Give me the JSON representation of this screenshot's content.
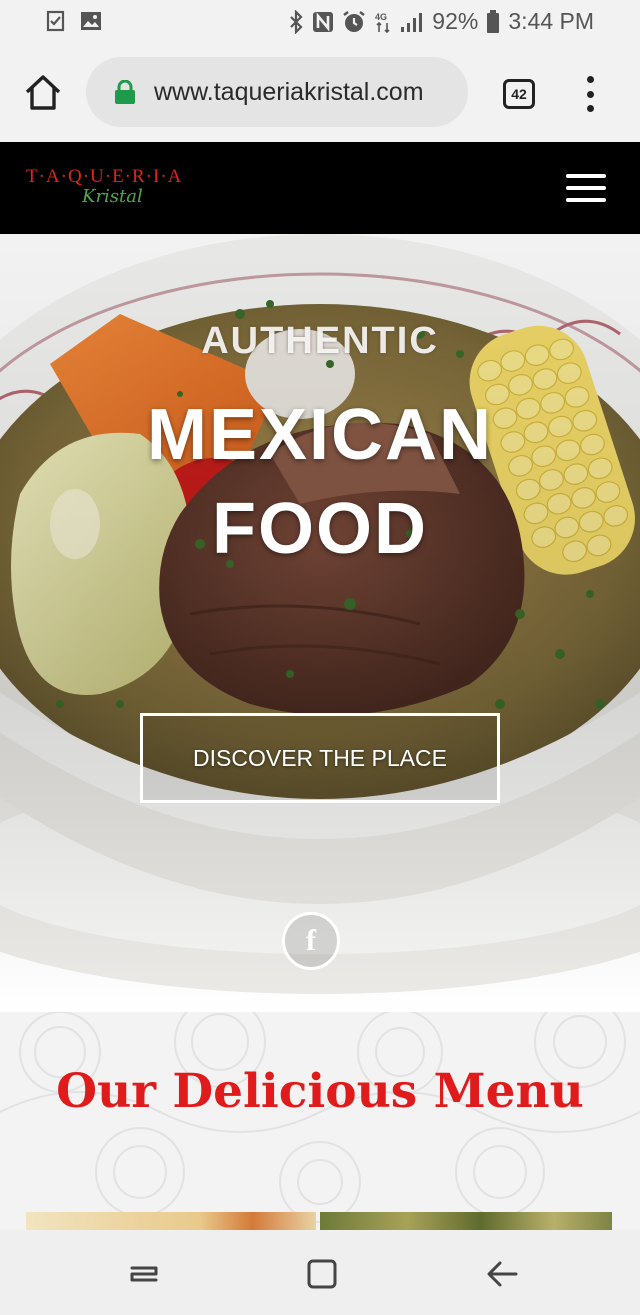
{
  "status_bar": {
    "battery": "92%",
    "time": "3:44 PM"
  },
  "browser": {
    "url": "www.taqueriakristal.com",
    "tab_count": "42"
  },
  "site_header": {
    "logo_top": "T·A·Q·U·E·R·I·A",
    "logo_bottom": "Kristal"
  },
  "hero": {
    "line1": "AUTHENTIC",
    "line2": "MEXICAN",
    "line3": "FOOD",
    "cta": "DISCOVER THE PLACE",
    "social_icon": "facebook-icon",
    "social_glyph": "f"
  },
  "menu": {
    "title": "Our Delicious Menu"
  },
  "colors": {
    "brand_red": "#e2231a",
    "brand_green": "#4fa84e",
    "header_bg": "#000000",
    "menu_title": "#e01b1b"
  }
}
